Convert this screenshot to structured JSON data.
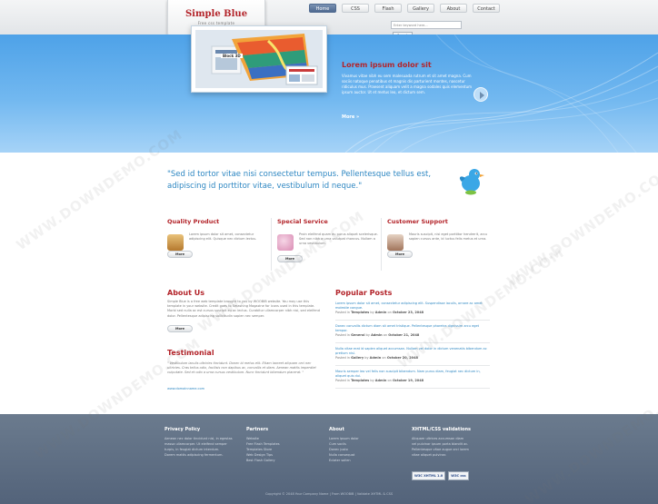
{
  "logo": {
    "title": "Simple Blue",
    "subtitle": "Free css template"
  },
  "nav": [
    "Home",
    "CSS",
    "Flash",
    "Gallery",
    "About",
    "Contact"
  ],
  "search": {
    "placeholder": "Enter keyword here...",
    "button": "Search"
  },
  "hero": {
    "title": "Lorem ipsum dolor sit",
    "text": "Vivamus vitae nibh eu sem malesuada rutrum et sit amet magna. Cum sociis natoque penatibus et magnis dis parturient montes, nascetur ridiculus mus. Praesent aliquam velit a magna sodales quis elementum ipsum auctor. Ut et metus leo, et dictum sem.",
    "more": "More »",
    "image_label": "Block 3D"
  },
  "quote": "\"Sed id tortor vitae nisi consectetur tempus. Pellentesque tellus est, adipiscing id porttitor vitae, vestibulum id neque.\"",
  "features": [
    {
      "title": "Quality Product",
      "text": "Lorem ipsum dolor sit amet, consectetur adipiscing elit. Quisque nec dictum lectus.",
      "more": "More"
    },
    {
      "title": "Special Service",
      "text": "Proin eleifend quam eu purus aliquet scelerisque. Sed non nibh a urna volutpat rhoncus. Nullam a urna vestibulum.",
      "more": "More"
    },
    {
      "title": "Customer Support",
      "text": "Mauris suscipit, nisi eget porttitor hendrerit, arcu sapien cursus ante, id luctus felis metus et urna.",
      "more": "More"
    }
  ],
  "about": {
    "title": "About Us",
    "text": "Simple Blue is a free web template brought to you by WOOBIB website. You may use this template in your website. Credit goes to Smashing Magazine for icons used in this template. Morbi sed nulla ac est cursus suscipit eu ac lectus. Curabitur ullamcorper nibh nisi, sed eleifend dolor. Pellentesque adipiscing sollicitudin sapien nec semper.",
    "more": "More"
  },
  "testimonial": {
    "title": "Testimonial",
    "text": "\" Vestibulum iaculis ultricies tincidunt. Donec id metus elit. Etiam laoreet aliquam orci nec ultricies. Cras tellus odio, facilisis non dapibus ac, convallis et diam. Aenean mattis imperdiet vulputate. Sed et odio a urna cursus vestibulum. Nunc tincidunt bibendum placerat. \"",
    "link": "www.domainname.com"
  },
  "popular": {
    "title": "Popular Posts",
    "posts": [
      {
        "title": "Lorem ipsum dolor sit amet, consectetur adipiscing elit. Suspendisse iaculis, ornare ac amet molestie congue.",
        "category": "Templates",
        "author": "Admin",
        "date": "October 23, 2048"
      },
      {
        "title": "Donec convallis dictum diam sit amet tristique. Pellentesque pharetra dignissim arcu eget tempor.",
        "category": "General",
        "author": "Admin",
        "date": "October 21, 2048"
      },
      {
        "title": "Nulla vitae erat id sapien aliquet accumsan. Nullam vel dolor in dictum venenatis bibendum ac pretium nisl.",
        "category": "Gallery",
        "author": "Admin",
        "date": "October 20, 2048"
      },
      {
        "title": "Mauris semper leo vel felis non suscipit bibendum. Nam purus diam, feugiat nec dictum in, aliquet quis dui.",
        "category": "Templates",
        "author": "Admin",
        "date": "October 19, 2048"
      }
    ]
  },
  "footer": {
    "cols": [
      {
        "title": "Privacy Policy",
        "lines": [
          "Aenean nec dolor tincidunt nisl, in egestas",
          "massa ullamcorper. Ut eleifend semper",
          "turpis, in feugiat dictum interdum.",
          "Dorem mattis adipiscing fermentum."
        ]
      },
      {
        "title": "Partners",
        "lines": [
          "Website",
          "Free Flash Templates",
          "Templates Store",
          "Web Design Tips",
          "Best Flash Gallery"
        ]
      },
      {
        "title": "About",
        "lines": [
          "Lorem ipsum dolor",
          "Cum sociis",
          "Donec justo",
          "Nulla consequat",
          "Eclater sollen"
        ]
      },
      {
        "title": "XHTML/CSS validations",
        "lines": [
          "Aliquam ultrices accumsan diam",
          "vel pulvinar ipsum porta blandit ac.",
          "Pellentesque vitae augue orci lorem",
          "vitae aliquet pulvinar."
        ]
      }
    ],
    "badges": [
      "W3C XHTML 1.0",
      "W3C css"
    ],
    "copyright": "Copyright © 2048 Your Company Name | From WOOBIB | Validate XHTML & CSS"
  },
  "watermark": "WWW.DOWNDEMO.COM",
  "colors": {
    "accent": "#b3242a",
    "link": "#2e87c2",
    "hero_top": "#4ea2e8",
    "footer": "#5f6f84"
  }
}
